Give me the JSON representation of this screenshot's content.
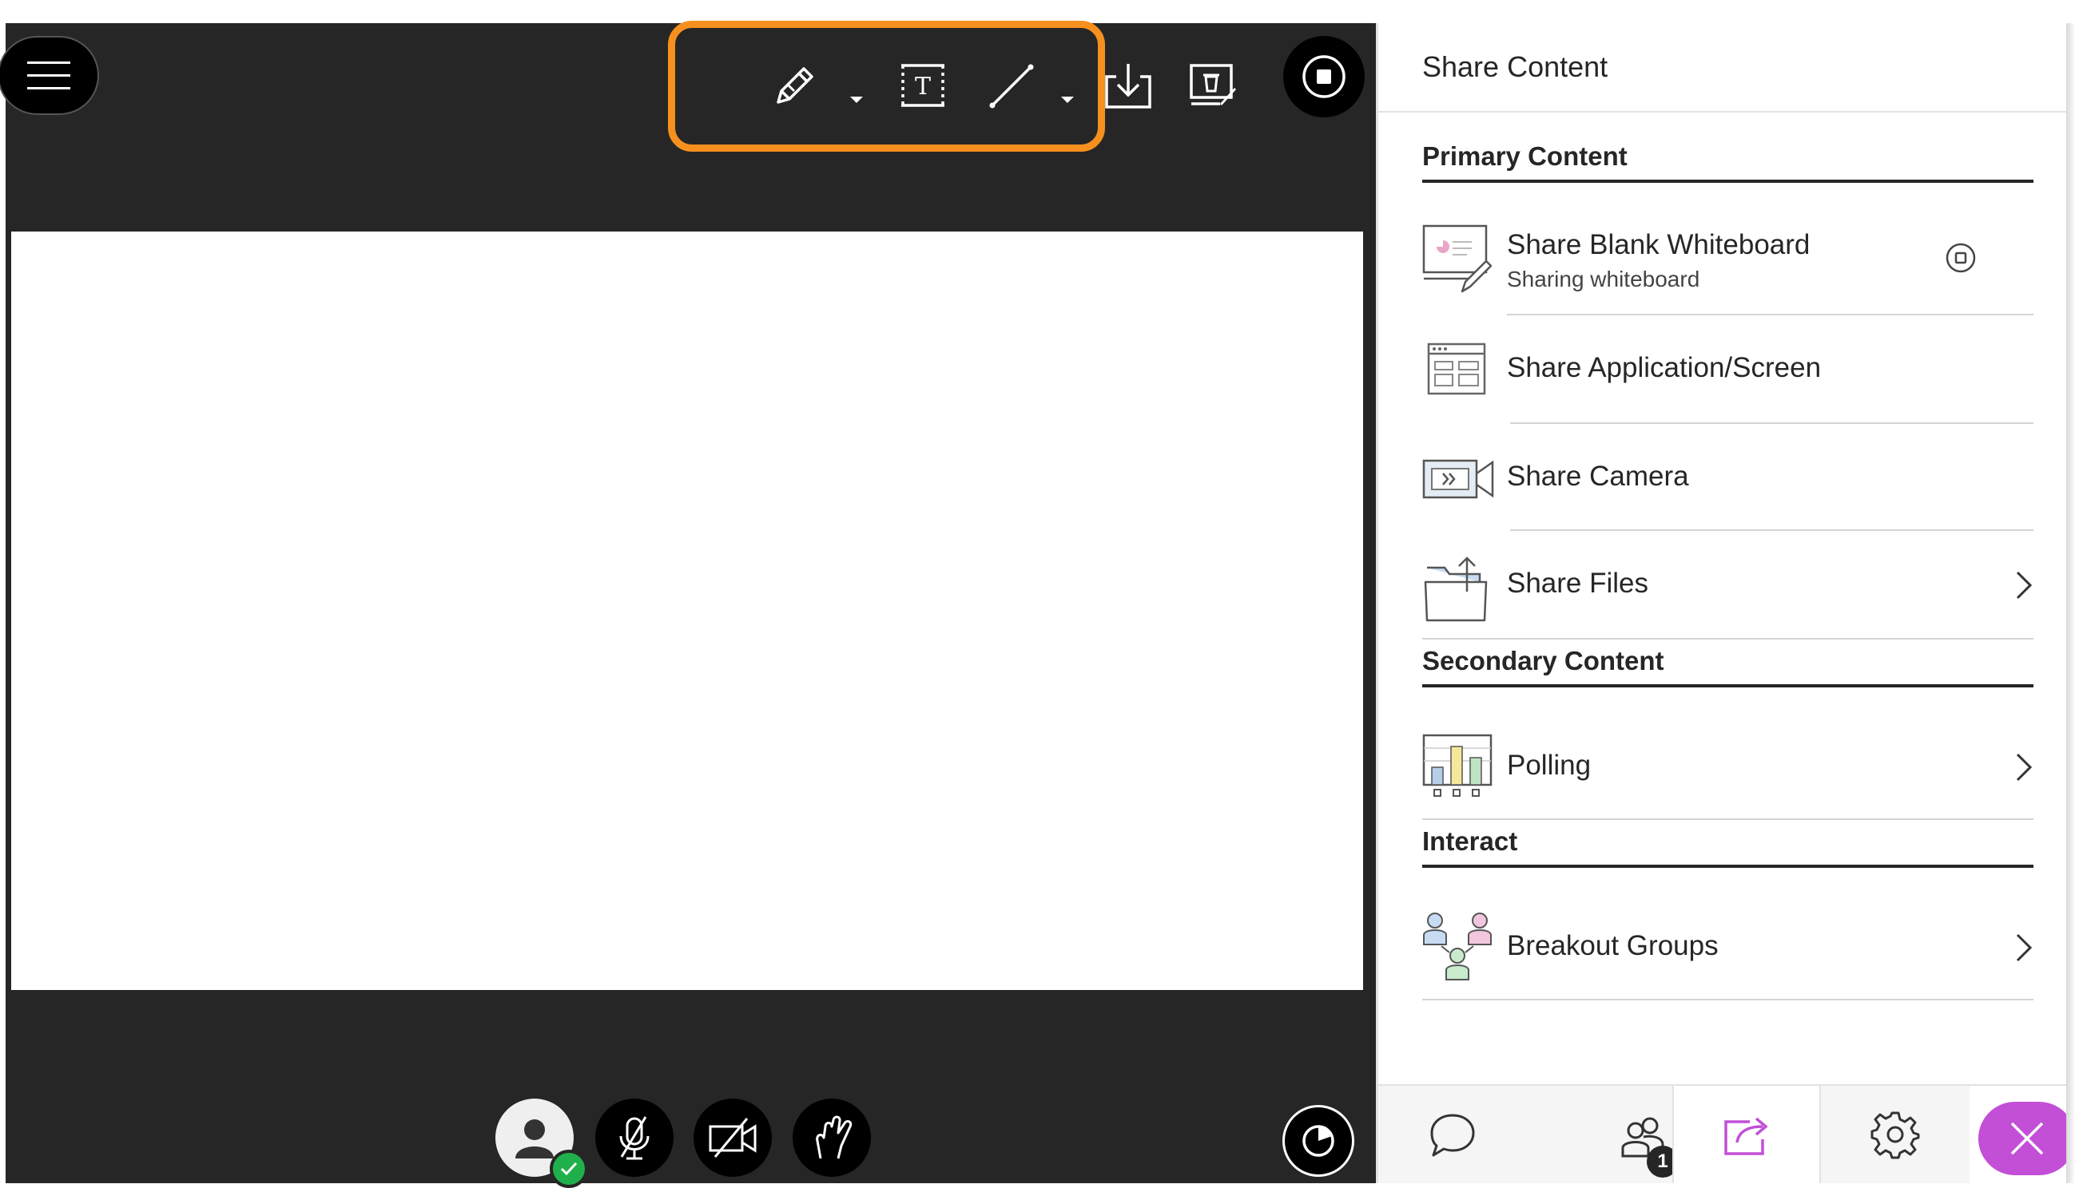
{
  "panel": {
    "title": "Share Content",
    "sections": {
      "primary": "Primary Content",
      "secondary": "Secondary Content",
      "interact": "Interact"
    },
    "items": {
      "whiteboard": {
        "label": "Share Blank Whiteboard",
        "sub": "Sharing whiteboard"
      },
      "screen": {
        "label": "Share Application/Screen"
      },
      "camera": {
        "label": "Share Camera"
      },
      "files": {
        "label": "Share Files"
      },
      "polling": {
        "label": "Polling"
      },
      "breakout": {
        "label": "Breakout Groups"
      }
    },
    "attendee_count": "1"
  },
  "colors": {
    "stage_bg": "#262626",
    "toolbar_highlight": "#f5901e",
    "active_tab_accent": "#c24fd6",
    "status_green": "#20b04b"
  },
  "icons": {
    "menu": "hamburger-icon",
    "pencil": "pencil-icon",
    "text": "text-tool-icon",
    "line": "line-tool-icon",
    "download": "download-icon",
    "clear": "clear-whiteboard-icon",
    "stop": "stop-sharing-icon",
    "chat": "chat-icon",
    "attendees": "attendees-icon",
    "share": "share-content-icon",
    "settings": "gear-icon",
    "close": "close-icon"
  }
}
